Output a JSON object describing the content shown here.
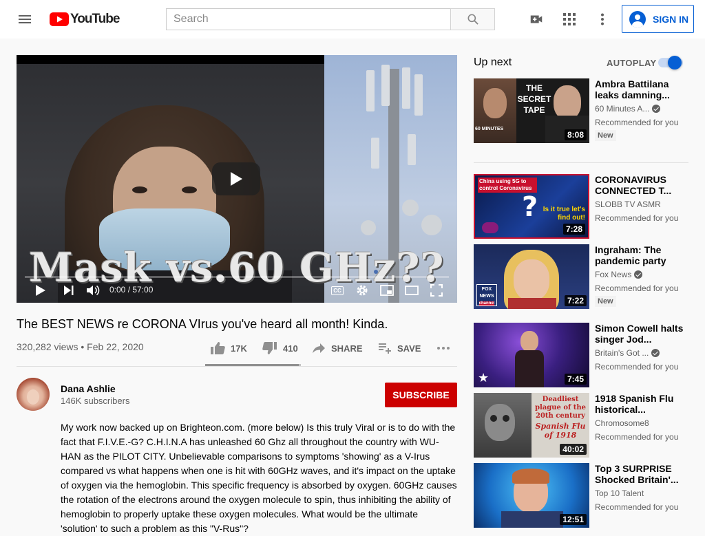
{
  "header": {
    "logo_text": "YouTube",
    "search_placeholder": "Search",
    "signin_label": "SIGN IN"
  },
  "player": {
    "overlay_text": "Mask vs.60 GHz??",
    "time": "0:00 / 57:00",
    "cc_label": "CC"
  },
  "video": {
    "title": "The BEST NEWS re CORONA VIrus you've heard all month! Kinda.",
    "views_date": "320,282 views • Feb 22, 2020",
    "likes": "17K",
    "dislikes": "410",
    "like_ratio": 0.976,
    "share_label": "SHARE",
    "save_label": "SAVE"
  },
  "owner": {
    "name": "Dana Ashlie",
    "subscribers": "146K subscribers",
    "subscribe_label": "SUBSCRIBE"
  },
  "description": "My work now backed up on Brighteon.com. (more below) Is this truly Viral or is to do with the fact that F.I.V.E.-G? C.H.I.N.A has unleashed 60 Ghz all throughout the country with WU-HAN as the PILOT CITY. Unbelievable comparisons to symptoms 'showing' as a V-Irus compared vs what happens when one is hit with 60GHz waves, and it's impact on the uptake of oxygen via the hemoglobin. This specific frequency is absorbed by oxygen. 60GHz causes the rotation of the electrons around the oxygen molecule to spin, thus inhibiting the ability of hemoglobin to properly uptake these oxygen molecules. What would be the ultimate 'solution' to such a problem as this \"V-Rus\"?",
  "sidebar": {
    "up_next": "Up next",
    "autoplay": "AUTOPLAY",
    "autoplay_on": true,
    "items": [
      {
        "title": "Ambra Battilana leaks damning...",
        "channel": "60 Minutes A...",
        "verified": true,
        "meta": "Recommended for you",
        "badge": "New",
        "duration": "8:08",
        "thumb_text": "THE SECRET TAPE",
        "thumb_sub": "60 MINUTES"
      },
      {
        "title": "CORONAVIRUS CONNECTED T...",
        "channel": "SLOBB TV ASMR",
        "verified": false,
        "meta": "Recommended for you",
        "badge": "",
        "duration": "7:28",
        "thumb_text": "China using 5G to control Coronavirus",
        "thumb_sub": "Is it true let's find out!"
      },
      {
        "title": "Ingraham: The pandemic party",
        "channel": "Fox News",
        "verified": true,
        "meta": "Recommended for you",
        "badge": "New",
        "duration": "7:22",
        "thumb_text": "FOX NEWS",
        "thumb_sub": "channel"
      },
      {
        "title": "Simon Cowell halts singer Jod...",
        "channel": "Britain's Got ...",
        "verified": true,
        "meta": "Recommended for you",
        "badge": "",
        "duration": "7:45",
        "thumb_text": "",
        "thumb_sub": ""
      },
      {
        "title": "1918 Spanish Flu historical...",
        "channel": "Chromosome8",
        "verified": false,
        "meta": "Recommended for you",
        "badge": "",
        "duration": "40:02",
        "thumb_text": "Deadliest plague of the 20th century",
        "thumb_sub": "Spanish Flu of 1918"
      },
      {
        "title": "Top 3 SURPRISE Shocked Britain'...",
        "channel": "Top 10 Talent",
        "verified": false,
        "meta": "Recommended for you",
        "badge": "",
        "duration": "12:51",
        "thumb_text": "",
        "thumb_sub": ""
      }
    ]
  },
  "colors": {
    "brand_red": "#ff0000",
    "subscribe_red": "#cc0000",
    "link_blue": "#065fd4",
    "background": "#f9f9f9"
  },
  "icons": [
    "menu-icon",
    "search-icon",
    "video-camera-icon",
    "apps-icon",
    "more-vert-icon",
    "account-icon",
    "play-icon",
    "next-icon",
    "volume-icon",
    "cc-icon",
    "settings-icon",
    "miniplayer-icon",
    "theater-icon",
    "fullscreen-icon",
    "thumb-up-icon",
    "thumb-down-icon",
    "share-icon",
    "playlist-add-icon",
    "more-horiz-icon",
    "verified-icon"
  ]
}
